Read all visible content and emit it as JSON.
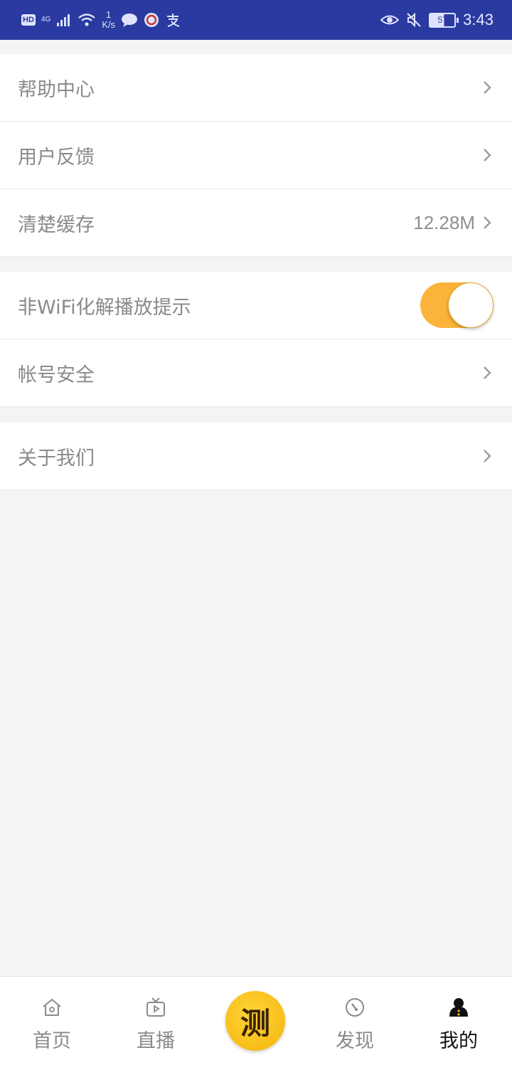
{
  "status_bar": {
    "hd": "HD",
    "network": "4G",
    "speed_value": "1",
    "speed_unit": "K/s",
    "battery": "57",
    "time": "3:43",
    "icons": [
      "chat-icon",
      "unionpay-icon",
      "alipay-icon",
      "eye-icon",
      "mute-icon"
    ]
  },
  "settings": {
    "group1": [
      {
        "label": "帮助中心"
      },
      {
        "label": "用户反馈"
      },
      {
        "label": "清楚缓存",
        "value": "12.28M"
      }
    ],
    "group2": [
      {
        "label": "非WiFi化解播放提示",
        "toggle_on": true
      },
      {
        "label": "帐号安全"
      }
    ],
    "group3": [
      {
        "label": "关于我们"
      }
    ]
  },
  "bottom_nav": {
    "tabs": [
      {
        "label": "首页",
        "icon": "home-icon"
      },
      {
        "label": "直播",
        "icon": "tv-icon"
      },
      {
        "label": "发现",
        "icon": "compass-icon"
      },
      {
        "label": "我的",
        "icon": "profile-icon",
        "active": true
      }
    ],
    "center_button": {
      "label": "测",
      "icon": "center-logo-icon"
    }
  },
  "colors": {
    "status_bar": "#2b3aa0",
    "accent": "#fbb33a",
    "background": "#f4f4f4"
  }
}
